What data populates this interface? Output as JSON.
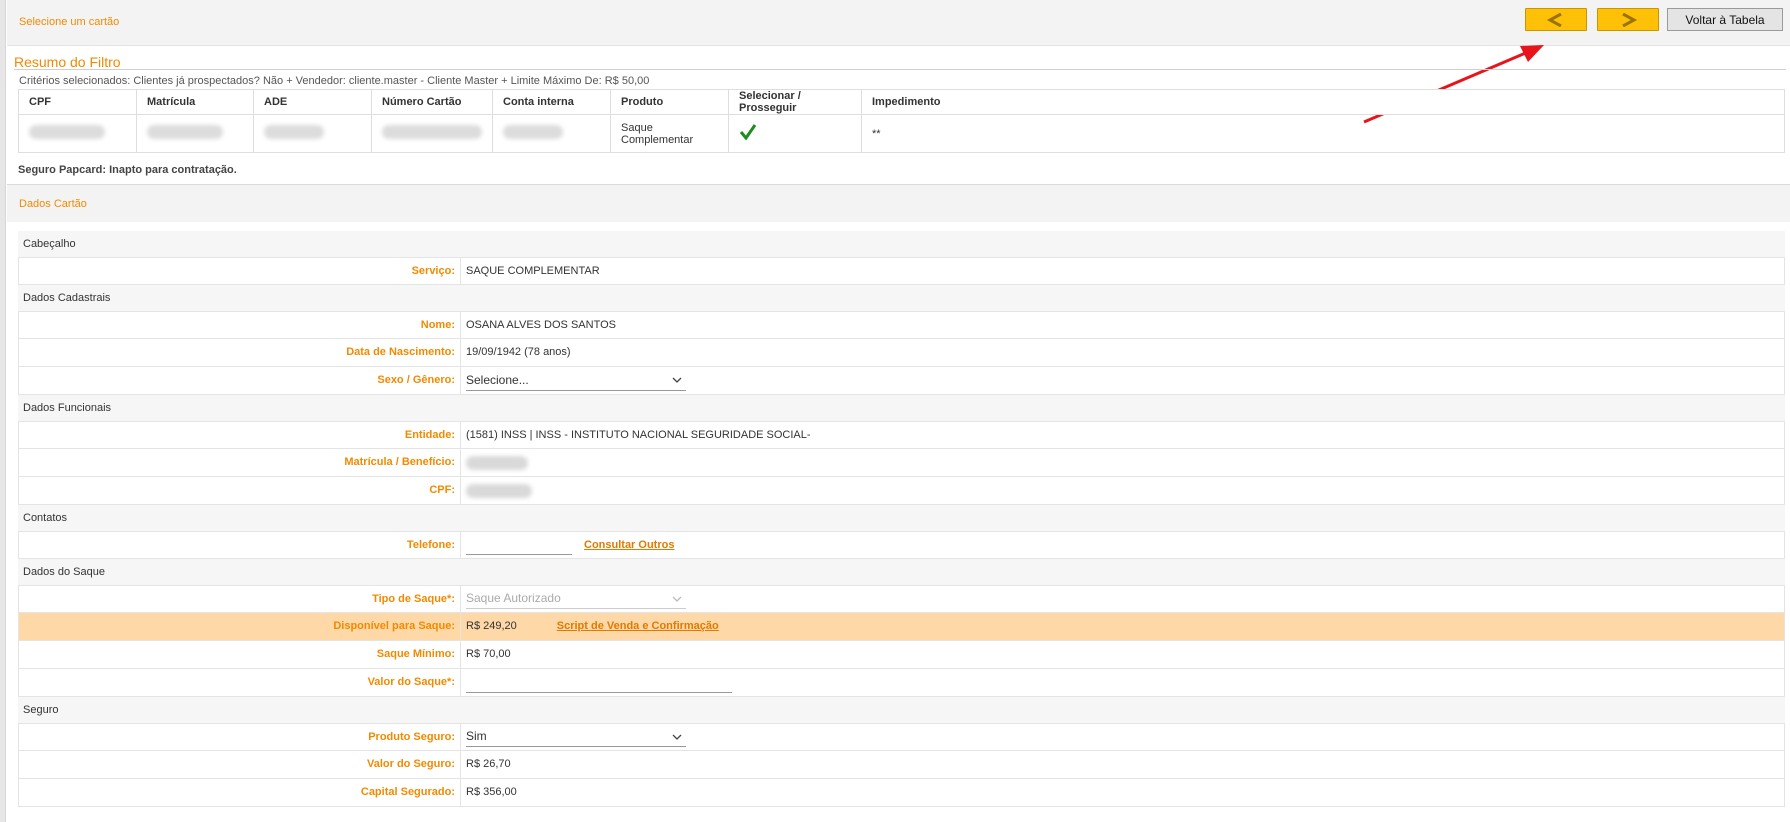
{
  "header": {
    "title": "Selecione um cartão",
    "prev_icon": "chevron-left-icon",
    "next_icon": "chevron-right-icon",
    "back_label": "Voltar à Tabela"
  },
  "resumo": {
    "title": "Resumo do Filtro",
    "criterios": "Critérios selecionados: Clientes já prospectados? Não + Vendedor: cliente.master - Cliente Master + Limite Máximo De: R$ 50,00"
  },
  "table": {
    "headers": [
      "CPF",
      "Matrícula",
      "ADE",
      "Número Cartão",
      "Conta interna",
      "Produto",
      "Selecionar / Prosseguir",
      "Impedimento"
    ],
    "row": {
      "produto_line1": "Saque",
      "produto_line2": "Complementar",
      "impedimento": "**"
    }
  },
  "seguro_papcard": "Seguro Papcard: Inapto para contratação.",
  "dados_cartao": "Dados Cartão",
  "sections": {
    "cabecalho": {
      "title": "Cabeçalho",
      "servico_label": "Serviço:",
      "servico_value": "SAQUE COMPLEMENTAR"
    },
    "cadastrais": {
      "title": "Dados Cadastrais",
      "nome_label": "Nome:",
      "nome_value": "OSANA ALVES DOS SANTOS",
      "nasc_label": "Data de Nascimento:",
      "nasc_value": "19/09/1942 (78 anos)",
      "sexo_label": "Sexo / Gênero:",
      "sexo_value": "Selecione..."
    },
    "funcionais": {
      "title": "Dados Funcionais",
      "entidade_label": "Entidade:",
      "entidade_value": "(1581) INSS | INSS - INSTITUTO NACIONAL SEGURIDADE SOCIAL-",
      "matricula_label": "Matrícula / Benefício:",
      "cpf_label": "CPF:"
    },
    "contatos": {
      "title": "Contatos",
      "telefone_label": "Telefone:",
      "consultar_label": "Consultar Outros"
    },
    "saque": {
      "title": "Dados do Saque",
      "tipo_label": "Tipo de Saque*:",
      "tipo_value": "Saque Autorizado",
      "disponivel_label": "Disponível para Saque:",
      "disponivel_value": "R$ 249,20",
      "script_label": "Script de Venda e Confirmação",
      "minimo_label": "Saque Mínimo:",
      "minimo_value": "R$ 70,00",
      "valor_label": "Valor do Saque*:"
    },
    "seguro": {
      "title": "Seguro",
      "produto_label": "Produto Seguro:",
      "produto_value": "Sim",
      "valor_label": "Valor do Seguro:",
      "valor_value": "R$ 26,70",
      "capital_label": "Capital Segurado:",
      "capital_value": "R$ 356,00"
    }
  },
  "colors": {
    "accent": "#f28a00",
    "nav_button": "#ffc107",
    "highlight_row": "#ffd8a8",
    "annotation_arrow": "#e8141b"
  }
}
